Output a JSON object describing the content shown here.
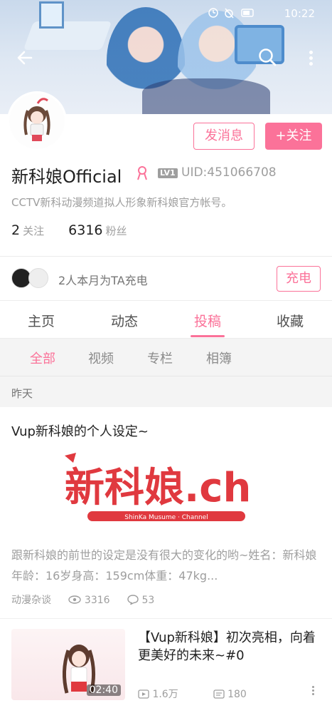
{
  "status_bar": {
    "time": "10:22",
    "icons": [
      "signal-icon",
      "wifi-icon",
      "alarm-icon",
      "mute-icon",
      "battery-icon"
    ]
  },
  "header": {
    "back_icon": "back-arrow-icon",
    "search_icon": "search-icon",
    "more_icon": "more-vertical-icon"
  },
  "profile": {
    "follow_message_label": "发消息",
    "follow_label": "+关注",
    "name": "新科娘Official",
    "level": "LV1",
    "uid": "UID:451066708",
    "bio": "CCTV新科动漫频道拟人形象新科娘官方帐号。",
    "following_count": "2",
    "following_label": "关注",
    "followers_count": "6316",
    "followers_label": "粉丝"
  },
  "charge": {
    "text": "2人本月为TA充电",
    "button_label": "充电"
  },
  "tabs": [
    {
      "label": "主页"
    },
    {
      "label": "动态"
    },
    {
      "label": "投稿",
      "active": true
    },
    {
      "label": "收藏"
    }
  ],
  "sub_filters": [
    {
      "label": "全部",
      "active": true
    },
    {
      "label": "视频"
    },
    {
      "label": "专栏"
    },
    {
      "label": "相簿"
    }
  ],
  "date_header": "昨天",
  "article": {
    "title": "Vup新科娘的个人设定~",
    "cover_logo": "新科娘.ch",
    "cover_subtitle": "ShinKa Musume · Channel",
    "excerpt": "跟新科娘的前世的设定是没有很大的变化的哟~姓名：新科娘年龄：16岁身高：159cm体重：47kg...",
    "category": "动漫杂谈",
    "views": "3316",
    "comments": "53"
  },
  "video": {
    "title": "【Vup新科娘】初次亮相，向着更美好的未来~#0",
    "duration": "02:40",
    "plays": "1.6万",
    "danmaku": "180"
  },
  "colors": {
    "accent": "#fb7299",
    "text": "#212121",
    "muted": "#9e9e9e"
  }
}
